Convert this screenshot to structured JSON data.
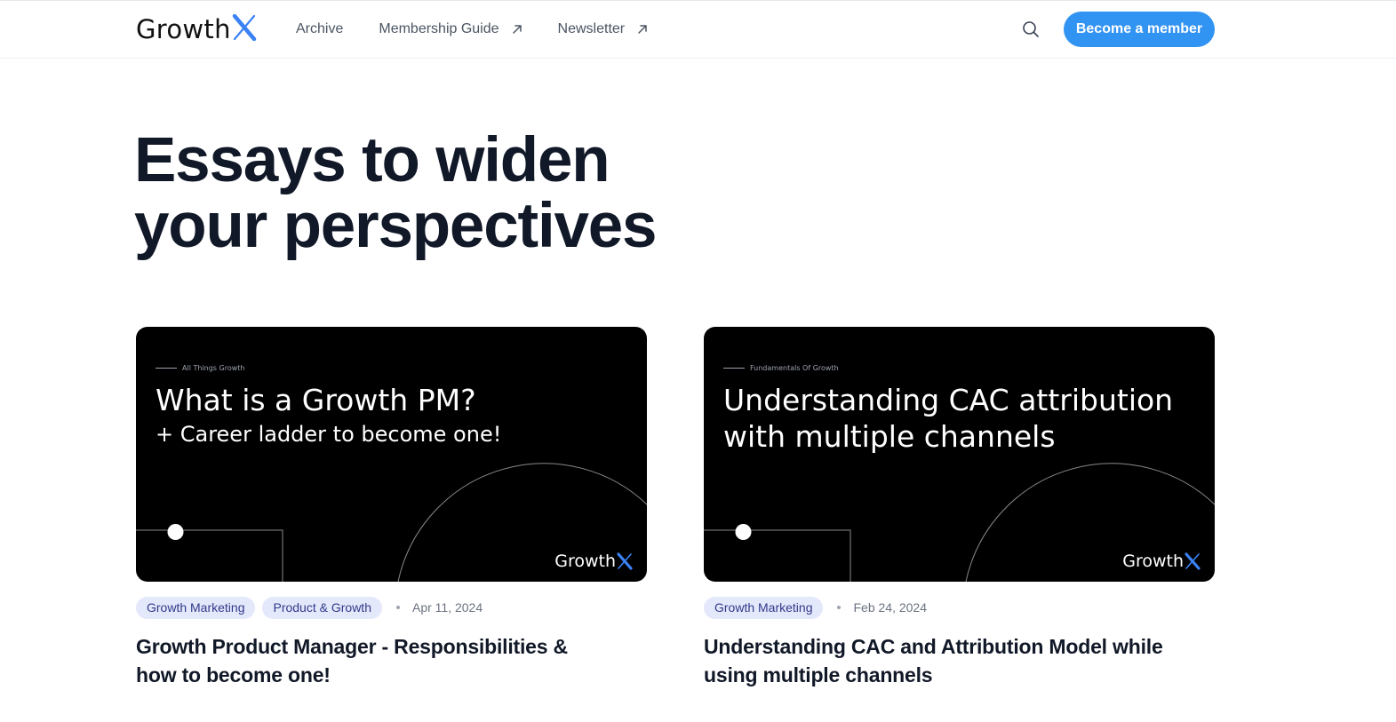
{
  "header": {
    "logo_text": "Growth",
    "nav": [
      {
        "label": "Archive",
        "external": false
      },
      {
        "label": "Membership Guide",
        "external": true
      },
      {
        "label": "Newsletter",
        "external": true
      }
    ],
    "cta_label": "Become a member",
    "search_icon": "search-icon"
  },
  "hero": {
    "line1": "Essays to widen",
    "line2": "your perspectives"
  },
  "cards": [
    {
      "thumb": {
        "kicker": "All Things Growth",
        "title": "What is a Growth PM?",
        "subtitle": "+ Career ladder to become one!",
        "logo_text": "Growth"
      },
      "tags": [
        "Growth Marketing",
        "Product & Growth"
      ],
      "date": "Apr 11, 2024",
      "title": "Growth Product Manager - Responsibilities & how to become one!"
    },
    {
      "thumb": {
        "kicker": "Fundamentals Of Growth",
        "title_line1": "Understanding CAC attribution",
        "title_line2": "with multiple channels",
        "logo_text": "Growth"
      },
      "tags": [
        "Growth Marketing"
      ],
      "date": "Feb 24, 2024",
      "title": "Understanding CAC and Attribution Model while using multiple channels"
    }
  ],
  "colors": {
    "accent": "#3193f2",
    "logo_x": "#3b82f6",
    "tag_bg": "#e4e8fb",
    "tag_text": "#2f3a8a",
    "heading": "#111827"
  }
}
